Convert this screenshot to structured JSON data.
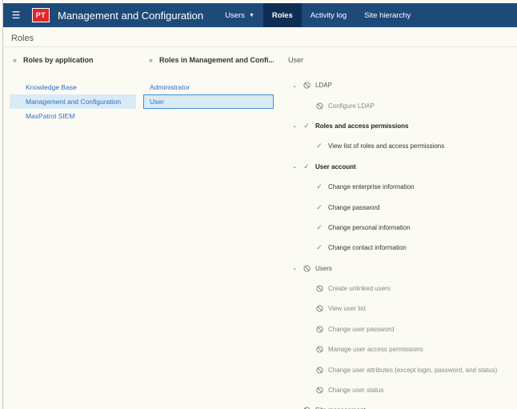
{
  "header": {
    "logo_text": "PT",
    "app_title": "Management and Configuration",
    "nav": [
      {
        "label": "Users",
        "has_dropdown": true,
        "active": false
      },
      {
        "label": "Roles",
        "has_dropdown": false,
        "active": true
      },
      {
        "label": "Activity log",
        "has_dropdown": false,
        "active": false
      },
      {
        "label": "Site hierarchy",
        "has_dropdown": false,
        "active": false
      }
    ]
  },
  "page": {
    "title": "Roles"
  },
  "col1": {
    "heading": "Roles by application",
    "items": [
      {
        "label": "Knowledge Base",
        "selected": false
      },
      {
        "label": "Management and Configuration",
        "selected": true
      },
      {
        "label": "MaxPatrol SIEM",
        "selected": false
      }
    ]
  },
  "col2": {
    "heading": "Roles in Management and Confi...",
    "items": [
      {
        "label": "Administrator",
        "selected": false
      },
      {
        "label": "User",
        "selected": true
      }
    ]
  },
  "col3": {
    "heading": "User",
    "rows": [
      {
        "level": 0,
        "label": "LDAP",
        "state": "denied"
      },
      {
        "level": 1,
        "label": "Configure LDAP",
        "state": "denied"
      },
      {
        "level": 0,
        "label": "Roles and access permissions",
        "state": "granted"
      },
      {
        "level": 1,
        "label": "View list of roles and access permissions",
        "state": "granted"
      },
      {
        "level": 0,
        "label": "User account",
        "state": "granted"
      },
      {
        "level": 1,
        "label": "Change enterprise information",
        "state": "granted"
      },
      {
        "level": 1,
        "label": "Change password",
        "state": "granted"
      },
      {
        "level": 1,
        "label": "Change personal information",
        "state": "granted"
      },
      {
        "level": 1,
        "label": "Change contact information",
        "state": "granted"
      },
      {
        "level": 0,
        "label": "Users",
        "state": "denied"
      },
      {
        "level": 1,
        "label": "Create unlinked users",
        "state": "denied"
      },
      {
        "level": 1,
        "label": "View user list",
        "state": "denied"
      },
      {
        "level": 1,
        "label": "Change user password",
        "state": "denied"
      },
      {
        "level": 1,
        "label": "Manage user access permissions",
        "state": "denied"
      },
      {
        "level": 1,
        "label": "Change user attributes (except login, password, and status)",
        "state": "denied"
      },
      {
        "level": 1,
        "label": "Change user status",
        "state": "denied"
      },
      {
        "level": 0,
        "label": "Site management",
        "state": "denied"
      }
    ]
  },
  "icons": {
    "menu": "hamburger-icon",
    "back": "chevron-left-double-icon",
    "granted": "check-icon",
    "denied": "prohibited-icon",
    "expand": "chevron-down-icon"
  },
  "colors": {
    "header_bg": "#1e4a7a",
    "nav_active_bg": "#0f2e52",
    "logo_bg": "#e4242a",
    "link": "#2e6fc0",
    "selected_bg": "#d9ebf7",
    "granted": "#3aa14e"
  }
}
